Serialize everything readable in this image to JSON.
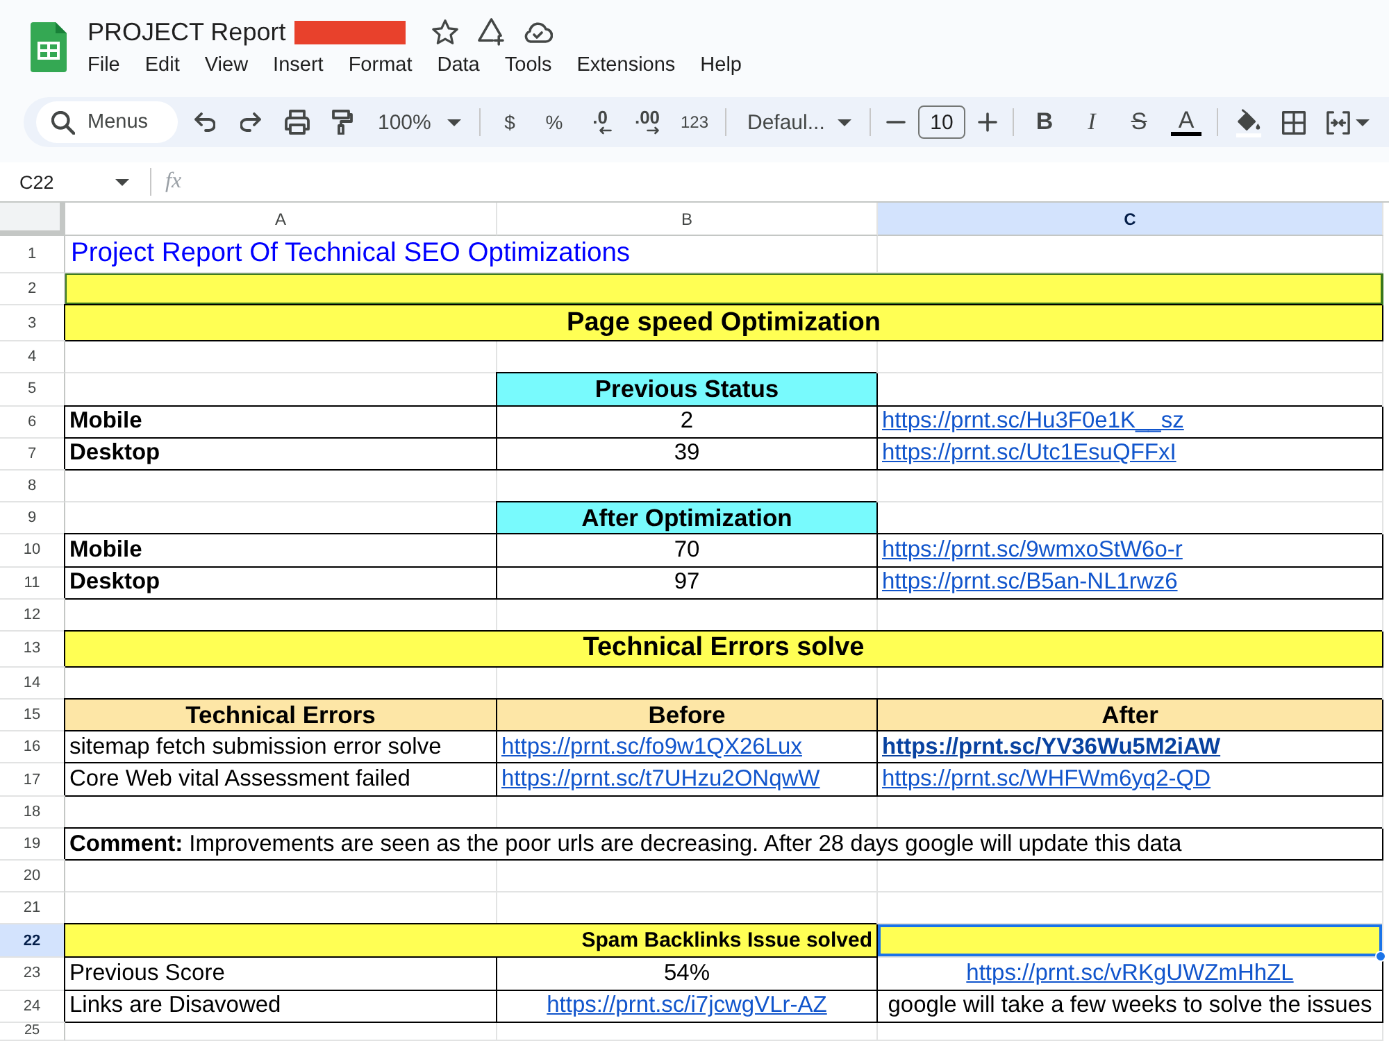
{
  "document": {
    "title": "PROJECT Report"
  },
  "menu": [
    "File",
    "Edit",
    "View",
    "Insert",
    "Format",
    "Data",
    "Tools",
    "Extensions",
    "Help"
  ],
  "toolbar": {
    "search": {
      "placeholder": "Menus"
    },
    "zoom": "100%",
    "currency": "$",
    "percent": "%",
    "decrease_decimal": ".0",
    "increase_decimal": ".00",
    "number_formats": "123",
    "font": "Defaul...",
    "font_size": "10",
    "bold": "B",
    "italic": "I",
    "strikethrough": "S",
    "text_color": "A"
  },
  "formula_bar": {
    "name_box": "C22",
    "function_label": "fx"
  },
  "sheet": {
    "columns": [
      {
        "label": "A",
        "selected": false
      },
      {
        "label": "B",
        "selected": false
      },
      {
        "label": "C",
        "selected": true
      }
    ],
    "rows": [
      {
        "number": "1",
        "selected": false,
        "kind": "title",
        "cells": [
          {
            "kind": "text",
            "text": "Project Report Of Technical SEO Optimizations"
          }
        ]
      },
      {
        "number": "2",
        "selected": false,
        "kind": "highlight"
      },
      {
        "number": "3",
        "selected": false,
        "kind": "band",
        "cells": [
          {
            "kind": "text",
            "text": "Page speed Optimization"
          }
        ]
      },
      {
        "number": "4",
        "selected": false,
        "kind": "blank"
      },
      {
        "number": "5",
        "selected": false,
        "kind": "status_header",
        "cells": [
          {
            "kind": "text",
            "text": "Previous Status"
          }
        ]
      },
      {
        "number": "6",
        "selected": false,
        "kind": "status",
        "cells": [
          {
            "kind": "text",
            "text": "Mobile"
          },
          {
            "kind": "text",
            "text": "2"
          },
          {
            "kind": "link",
            "text": "https://prnt.sc/Hu3F0e1K__sz",
            "bold": false
          }
        ]
      },
      {
        "number": "7",
        "selected": false,
        "kind": "status",
        "cells": [
          {
            "kind": "text",
            "text": "Desktop"
          },
          {
            "kind": "text",
            "text": "39"
          },
          {
            "kind": "link",
            "text": "https://prnt.sc/Utc1EsuQFFxI",
            "bold": false
          }
        ]
      },
      {
        "number": "8",
        "selected": false,
        "kind": "blank"
      },
      {
        "number": "9",
        "selected": false,
        "kind": "status_header",
        "cells": [
          {
            "kind": "text",
            "text": "After Optimization"
          }
        ]
      },
      {
        "number": "10",
        "selected": false,
        "kind": "status",
        "cells": [
          {
            "kind": "text",
            "text": "Mobile"
          },
          {
            "kind": "text",
            "text": "70"
          },
          {
            "kind": "link",
            "text": "https://prnt.sc/9wmxoStW6o-r",
            "bold": false
          }
        ]
      },
      {
        "number": "11",
        "selected": false,
        "kind": "status",
        "cells": [
          {
            "kind": "text",
            "text": "Desktop"
          },
          {
            "kind": "text",
            "text": "97"
          },
          {
            "kind": "link",
            "text": "https://prnt.sc/B5an-NL1rwz6",
            "bold": false
          }
        ]
      },
      {
        "number": "12",
        "selected": false,
        "kind": "blank"
      },
      {
        "number": "13",
        "selected": false,
        "kind": "band",
        "cells": [
          {
            "kind": "text",
            "text": "Technical Errors solve"
          }
        ]
      },
      {
        "number": "14",
        "selected": false,
        "kind": "blank"
      },
      {
        "number": "15",
        "selected": false,
        "kind": "table_header",
        "cells": [
          {
            "kind": "text",
            "text": "Technical Errors"
          },
          {
            "kind": "text",
            "text": "Before"
          },
          {
            "kind": "text",
            "text": "After"
          }
        ]
      },
      {
        "number": "16",
        "selected": false,
        "kind": "table",
        "cells": [
          {
            "kind": "text",
            "text": "sitemap fetch submission error solve"
          },
          {
            "kind": "link",
            "text": "https://prnt.sc/fo9w1QX26Lux",
            "bold": false
          },
          {
            "kind": "link",
            "text": "https://prnt.sc/YV36Wu5M2iAW",
            "bold": true
          }
        ]
      },
      {
        "number": "17",
        "selected": false,
        "kind": "table",
        "cells": [
          {
            "kind": "text",
            "text": "Core Web vital Assessment failed"
          },
          {
            "kind": "link",
            "text": "https://prnt.sc/t7UHzu2ONqwW",
            "bold": false
          },
          {
            "kind": "link",
            "text": "https://prnt.sc/WHFWm6yq2-QD",
            "bold": false
          }
        ]
      },
      {
        "number": "18",
        "selected": false,
        "kind": "blank"
      },
      {
        "number": "19",
        "selected": false,
        "kind": "comment",
        "cells": [
          {
            "kind": "text",
            "text": "**Comment:** Improvements are seen as the poor urls are decreasing. After 28 days google will update this data"
          }
        ]
      },
      {
        "number": "20",
        "selected": false,
        "kind": "blank"
      },
      {
        "number": "21",
        "selected": false,
        "kind": "blank"
      },
      {
        "number": "22",
        "selected": true,
        "kind": "section",
        "cells": [
          {
            "kind": "text",
            "text": "Spam Backlinks Issue solved"
          }
        ]
      },
      {
        "number": "23",
        "selected": false,
        "kind": "score",
        "cells": [
          {
            "kind": "text",
            "text": "Previous Score"
          },
          {
            "kind": "text",
            "text": "54%"
          },
          {
            "kind": "link",
            "text": "https://prnt.sc/vRKgUWZmHhZL",
            "bold": false
          }
        ]
      },
      {
        "number": "24",
        "selected": false,
        "kind": "score",
        "cells": [
          {
            "kind": "text",
            "text": "Links are Disavowed"
          },
          {
            "kind": "link",
            "text": "https://prnt.sc/i7jcwgVLr-AZ",
            "bold": false
          },
          {
            "kind": "text",
            "text": "google will take a few weeks to solve the issues"
          }
        ]
      },
      {
        "number": "25",
        "selected": false,
        "kind": "blank"
      }
    ]
  }
}
